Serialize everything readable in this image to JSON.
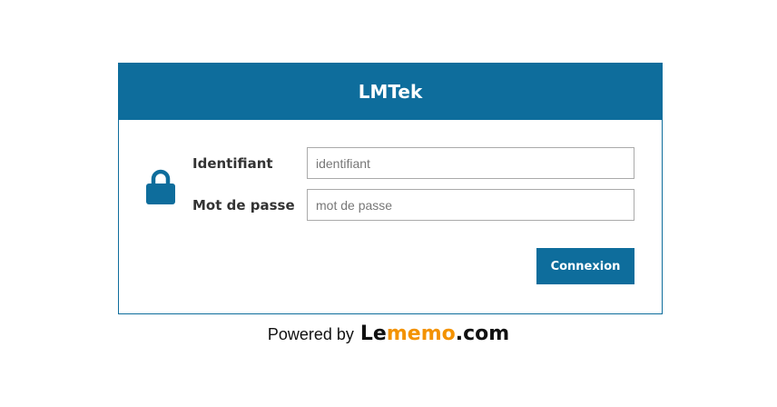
{
  "header": {
    "title": "LMTek"
  },
  "form": {
    "username_label": "Identifiant",
    "username_placeholder": "identifiant",
    "username_value": "",
    "password_label": "Mot de passe",
    "password_placeholder": "mot de passe",
    "password_value": "",
    "submit_label": "Connexion"
  },
  "icons": {
    "lock": "lock-icon"
  },
  "footer": {
    "powered_text": "Powered by",
    "brand_part1": "Le",
    "brand_part2": "memo",
    "brand_part3": ".com"
  },
  "colors": {
    "primary": "#0e6d9c",
    "brand_accent": "#f39200"
  }
}
